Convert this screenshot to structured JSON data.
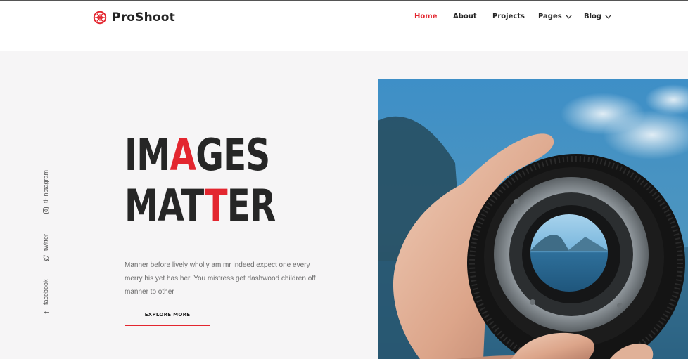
{
  "brand": {
    "name": "ProShoot",
    "accent_color": "#e3262f",
    "text_color": "#262626"
  },
  "nav": {
    "items": [
      {
        "label": "Home",
        "active": true,
        "dropdown": false
      },
      {
        "label": "About",
        "active": false,
        "dropdown": false
      },
      {
        "label": "Projects",
        "active": false,
        "dropdown": false
      },
      {
        "label": "Pages",
        "active": false,
        "dropdown": true
      },
      {
        "label": "Blog",
        "active": false,
        "dropdown": true
      }
    ]
  },
  "social": [
    {
      "label": "ti-instagram",
      "icon": "instagram-icon"
    },
    {
      "label": "twitter",
      "icon": "twitter-icon"
    },
    {
      "label": "facebook",
      "icon": "facebook-icon"
    }
  ],
  "hero": {
    "headline_line1_a": "IM",
    "headline_line1_b": "A",
    "headline_line1_c": "GES",
    "headline_line2_a": "MAT",
    "headline_line2_b": "T",
    "headline_line2_c": "ER",
    "description": "Manner before lively wholly am mr indeed expect one every merry his yet has her. You mistress get dashwood children off manner to other",
    "cta_label": "EXPLORE MORE",
    "image": "hand-holding-camera-lens-photo"
  }
}
